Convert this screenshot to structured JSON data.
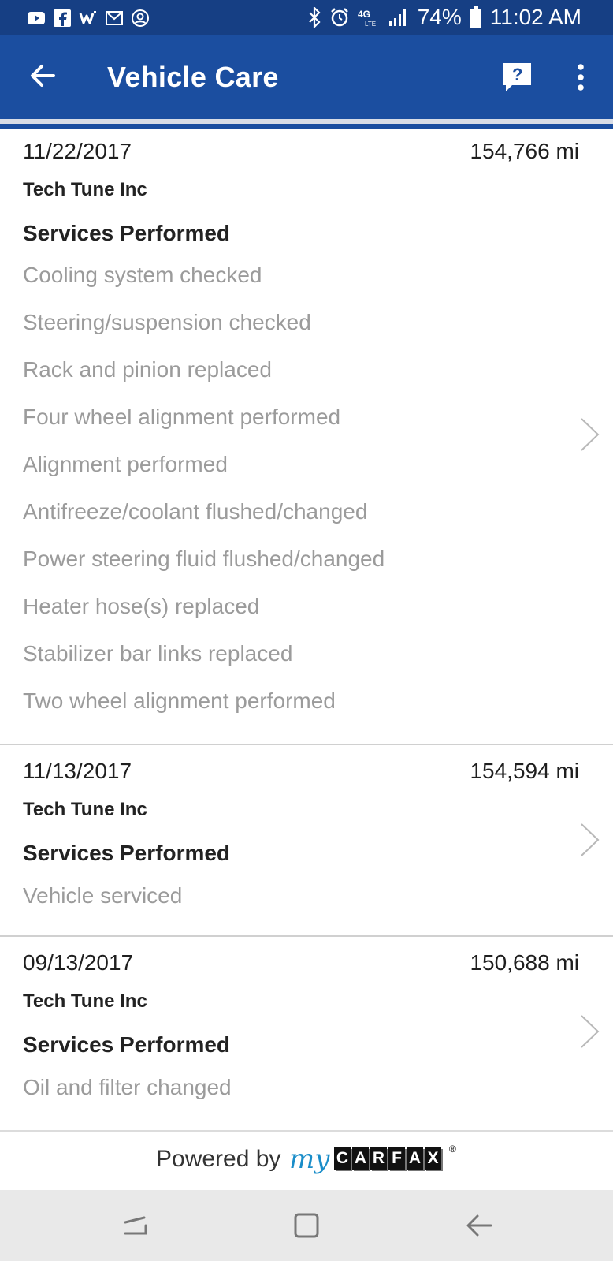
{
  "status_bar": {
    "battery": "74%",
    "time": "11:02 AM",
    "network": "4G LTE",
    "icons_left": [
      "youtube-icon",
      "facebook-icon",
      "wish-icon",
      "mail-icon",
      "account-circle-icon"
    ],
    "icons_right": [
      "bluetooth-icon",
      "alarm-icon",
      "lte-icon",
      "signal-icon",
      "battery-icon"
    ]
  },
  "app_bar": {
    "title": "Vehicle Care",
    "back_icon": "arrow-left-icon",
    "help_icon": "help-chat-icon",
    "menu_icon": "more-vert-icon",
    "color": "#1b4ea0"
  },
  "records": [
    {
      "date": "11/22/2017",
      "mileage": "154,766 mi",
      "shop": "Tech Tune Inc",
      "services_heading": "Services Performed",
      "services": [
        "Cooling system checked",
        "Steering/suspension checked",
        "Rack and pinion replaced",
        "Four wheel alignment performed",
        "Alignment performed",
        "Antifreeze/coolant flushed/changed",
        "Power steering fluid flushed/changed",
        "Heater hose(s) replaced",
        "Stabilizer bar links replaced",
        "Two wheel alignment performed"
      ]
    },
    {
      "date": "11/13/2017",
      "mileage": "154,594 mi",
      "shop": "Tech Tune Inc",
      "services_heading": "Services Performed",
      "services": [
        "Vehicle serviced"
      ]
    },
    {
      "date": "09/13/2017",
      "mileage": "150,688 mi",
      "shop": "Tech Tune Inc",
      "services_heading": "Services Performed",
      "services": [
        "Oil and filter changed"
      ]
    }
  ],
  "footer": {
    "powered_by": "Powered by",
    "logo_my": "my",
    "logo_letters": [
      "C",
      "A",
      "R",
      "F",
      "A",
      "X"
    ],
    "logo_reg": "®"
  },
  "nav_bar": {
    "icons": [
      "recent-apps-icon",
      "home-icon",
      "back-icon"
    ]
  },
  "colors": {
    "status_bar": "#163f84",
    "app_bar": "#1b4ea0",
    "service_text": "#9b9b9b",
    "nav_bar": "#e9e9e9"
  }
}
